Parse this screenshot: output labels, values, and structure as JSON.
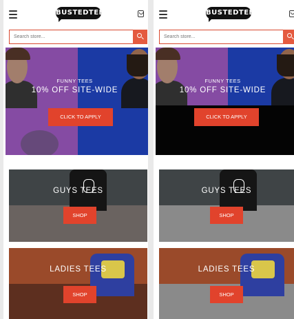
{
  "header": {
    "logo_text": "BUSTEDTEES"
  },
  "search": {
    "placeholder": "Search store..."
  },
  "hero": {
    "subtitle": "FUNNY TEES",
    "title": "10% OFF SITE-WIDE",
    "cta_label": "CLICK TO APPLY"
  },
  "categories": [
    {
      "title": "GUYS TEES",
      "button_label": "SHOP"
    },
    {
      "title": "LADIES TEES",
      "button_label": "SHOP"
    }
  ],
  "colors": {
    "accent": "#e1432c",
    "search_border": "#d9482f",
    "hero_purple": "#a35cc7",
    "hero_blue": "#2247c8"
  },
  "icons": {
    "menu": "hamburger-menu-icon",
    "cart": "shopping-bag-icon",
    "search": "search-icon"
  }
}
